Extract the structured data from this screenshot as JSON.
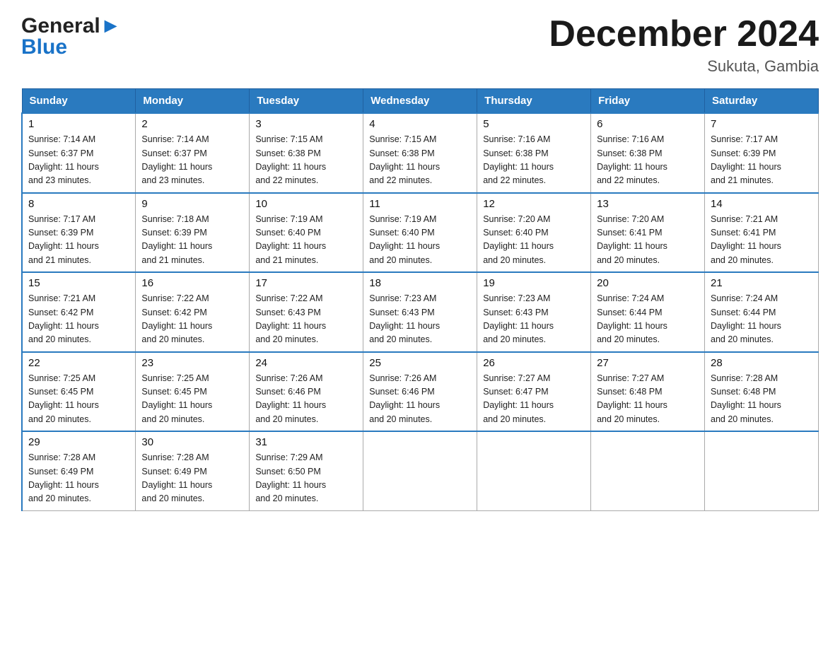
{
  "header": {
    "logo_line1": "General",
    "logo_line2": "Blue",
    "month_title": "December 2024",
    "location": "Sukuta, Gambia"
  },
  "weekdays": [
    "Sunday",
    "Monday",
    "Tuesday",
    "Wednesday",
    "Thursday",
    "Friday",
    "Saturday"
  ],
  "weeks": [
    [
      {
        "day": "1",
        "sunrise": "7:14 AM",
        "sunset": "6:37 PM",
        "daylight": "11 hours and 23 minutes."
      },
      {
        "day": "2",
        "sunrise": "7:14 AM",
        "sunset": "6:37 PM",
        "daylight": "11 hours and 23 minutes."
      },
      {
        "day": "3",
        "sunrise": "7:15 AM",
        "sunset": "6:38 PM",
        "daylight": "11 hours and 22 minutes."
      },
      {
        "day": "4",
        "sunrise": "7:15 AM",
        "sunset": "6:38 PM",
        "daylight": "11 hours and 22 minutes."
      },
      {
        "day": "5",
        "sunrise": "7:16 AM",
        "sunset": "6:38 PM",
        "daylight": "11 hours and 22 minutes."
      },
      {
        "day": "6",
        "sunrise": "7:16 AM",
        "sunset": "6:38 PM",
        "daylight": "11 hours and 22 minutes."
      },
      {
        "day": "7",
        "sunrise": "7:17 AM",
        "sunset": "6:39 PM",
        "daylight": "11 hours and 21 minutes."
      }
    ],
    [
      {
        "day": "8",
        "sunrise": "7:17 AM",
        "sunset": "6:39 PM",
        "daylight": "11 hours and 21 minutes."
      },
      {
        "day": "9",
        "sunrise": "7:18 AM",
        "sunset": "6:39 PM",
        "daylight": "11 hours and 21 minutes."
      },
      {
        "day": "10",
        "sunrise": "7:19 AM",
        "sunset": "6:40 PM",
        "daylight": "11 hours and 21 minutes."
      },
      {
        "day": "11",
        "sunrise": "7:19 AM",
        "sunset": "6:40 PM",
        "daylight": "11 hours and 20 minutes."
      },
      {
        "day": "12",
        "sunrise": "7:20 AM",
        "sunset": "6:40 PM",
        "daylight": "11 hours and 20 minutes."
      },
      {
        "day": "13",
        "sunrise": "7:20 AM",
        "sunset": "6:41 PM",
        "daylight": "11 hours and 20 minutes."
      },
      {
        "day": "14",
        "sunrise": "7:21 AM",
        "sunset": "6:41 PM",
        "daylight": "11 hours and 20 minutes."
      }
    ],
    [
      {
        "day": "15",
        "sunrise": "7:21 AM",
        "sunset": "6:42 PM",
        "daylight": "11 hours and 20 minutes."
      },
      {
        "day": "16",
        "sunrise": "7:22 AM",
        "sunset": "6:42 PM",
        "daylight": "11 hours and 20 minutes."
      },
      {
        "day": "17",
        "sunrise": "7:22 AM",
        "sunset": "6:43 PM",
        "daylight": "11 hours and 20 minutes."
      },
      {
        "day": "18",
        "sunrise": "7:23 AM",
        "sunset": "6:43 PM",
        "daylight": "11 hours and 20 minutes."
      },
      {
        "day": "19",
        "sunrise": "7:23 AM",
        "sunset": "6:43 PM",
        "daylight": "11 hours and 20 minutes."
      },
      {
        "day": "20",
        "sunrise": "7:24 AM",
        "sunset": "6:44 PM",
        "daylight": "11 hours and 20 minutes."
      },
      {
        "day": "21",
        "sunrise": "7:24 AM",
        "sunset": "6:44 PM",
        "daylight": "11 hours and 20 minutes."
      }
    ],
    [
      {
        "day": "22",
        "sunrise": "7:25 AM",
        "sunset": "6:45 PM",
        "daylight": "11 hours and 20 minutes."
      },
      {
        "day": "23",
        "sunrise": "7:25 AM",
        "sunset": "6:45 PM",
        "daylight": "11 hours and 20 minutes."
      },
      {
        "day": "24",
        "sunrise": "7:26 AM",
        "sunset": "6:46 PM",
        "daylight": "11 hours and 20 minutes."
      },
      {
        "day": "25",
        "sunrise": "7:26 AM",
        "sunset": "6:46 PM",
        "daylight": "11 hours and 20 minutes."
      },
      {
        "day": "26",
        "sunrise": "7:27 AM",
        "sunset": "6:47 PM",
        "daylight": "11 hours and 20 minutes."
      },
      {
        "day": "27",
        "sunrise": "7:27 AM",
        "sunset": "6:48 PM",
        "daylight": "11 hours and 20 minutes."
      },
      {
        "day": "28",
        "sunrise": "7:28 AM",
        "sunset": "6:48 PM",
        "daylight": "11 hours and 20 minutes."
      }
    ],
    [
      {
        "day": "29",
        "sunrise": "7:28 AM",
        "sunset": "6:49 PM",
        "daylight": "11 hours and 20 minutes."
      },
      {
        "day": "30",
        "sunrise": "7:28 AM",
        "sunset": "6:49 PM",
        "daylight": "11 hours and 20 minutes."
      },
      {
        "day": "31",
        "sunrise": "7:29 AM",
        "sunset": "6:50 PM",
        "daylight": "11 hours and 20 minutes."
      },
      null,
      null,
      null,
      null
    ]
  ]
}
